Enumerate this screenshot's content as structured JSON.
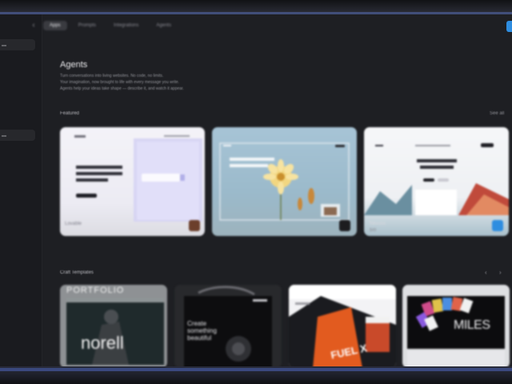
{
  "app": {
    "tabs": [
      "Apps",
      "Prompts",
      "Integrations",
      "Agents"
    ],
    "active_tab": 0
  },
  "page": {
    "title": "Agents",
    "description": [
      "Turn conversations into living websites. No code, no limits.",
      "Your imagination, now brought to life with every message you write.",
      "Agents help your ideas take shape — describe it, and watch it appear."
    ]
  },
  "featured": {
    "title": "Featured",
    "link": "See all",
    "cards": [
      {
        "name": "Lovable",
        "sub": "",
        "headline": "Build something lovable"
      },
      {
        "name": "",
        "sub": "",
        "headline": "Build, design on Framer"
      },
      {
        "name": "Nexuss",
        "sub": "$49",
        "headline": "Scale faster with your AI Agent"
      }
    ]
  },
  "templates": {
    "title": "Craft Templates",
    "cards": [
      {
        "headline": "PORTFOLIO",
        "text": "norell"
      },
      {
        "headline": "Create something beautiful",
        "text": ""
      },
      {
        "headline": "FUEL X",
        "text": ""
      },
      {
        "headline": "MILES",
        "text": ""
      }
    ]
  },
  "colors": {
    "background": "#1e1f23",
    "accent_blue": "#2e8de0",
    "bezel_blue": "#4a5a8e"
  }
}
